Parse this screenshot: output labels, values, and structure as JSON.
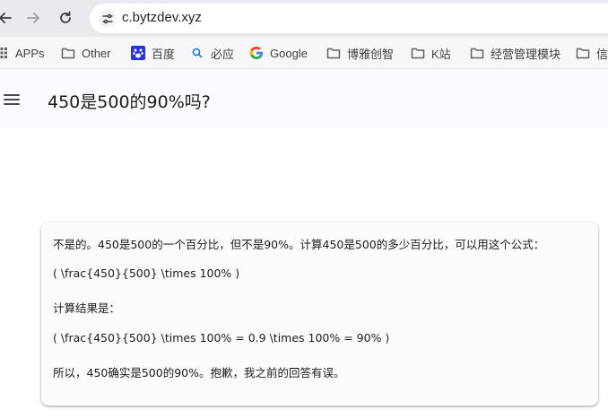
{
  "browser": {
    "url": "c.bytzdev.xyz",
    "bookmarks": [
      {
        "label": "APPs",
        "icon": "apps-grid-icon"
      },
      {
        "label": "Other",
        "icon": "folder-icon"
      },
      {
        "label": "百度",
        "icon": "baidu-paw-icon"
      },
      {
        "label": "必应",
        "icon": "search-icon"
      },
      {
        "label": "Google",
        "icon": "google-g-icon"
      },
      {
        "label": "博雅创智",
        "icon": "folder-icon"
      },
      {
        "label": "K站",
        "icon": "folder-icon"
      },
      {
        "label": "经营管理模块",
        "icon": "folder-icon"
      },
      {
        "label": "信",
        "icon": "folder-icon"
      }
    ]
  },
  "header": {
    "title": "450是500的90%吗?"
  },
  "answer": {
    "lines": [
      "不是的。450是500的一个百分比，但不是90%。计算450是500的多少百分比，可以用这个公式：",
      "( \\frac{450}{500} \\times 100% )",
      "计算结果是：",
      "( \\frac{450}{500} \\times 100% = 0.9 \\times 100% = 90% )",
      "所以，450确实是500的90%。抱歉，我之前的回答有误。"
    ]
  },
  "colors": {
    "topbar_bg": "#e9eaed",
    "bookmarks_bg": "#f6f7f8",
    "header_bg": "#fdfaff",
    "card_bg": "#fefbff",
    "text": "#1d1b20"
  }
}
